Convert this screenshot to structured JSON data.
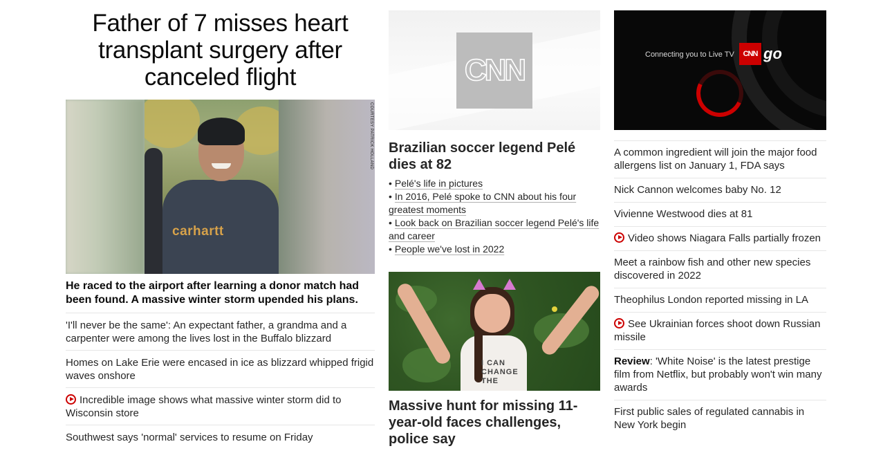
{
  "left": {
    "headline": "Father of 7 misses heart transplant surgery after canceled flight",
    "photo_credit": "COURTESY PATRICK HOLLAND",
    "shirt_logo": "carhartt",
    "caption": "He raced to the airport after learning a donor match had been found. A massive winter storm upended his plans.",
    "related": [
      {
        "text": "'I'll never be the same': An expectant father, a grandma and a carpenter were among the lives lost in the Buffalo blizzard",
        "video": false
      },
      {
        "text": "Homes on Lake Erie were encased in ice as blizzard whipped frigid waves onshore",
        "video": false
      },
      {
        "text": "Incredible image shows what massive winter storm did to Wisconsin store",
        "video": true
      },
      {
        "text": "Southwest says 'normal' services to resume on Friday",
        "video": false
      }
    ]
  },
  "middle": {
    "cnn_logo_text": "CNN",
    "headline": "Brazilian soccer legend Pelé dies at 82",
    "bullets": [
      "Pelé's life in pictures",
      "In 2016, Pelé spoke to CNN about his four greatest moments",
      "Look back on Brazilian soccer legend Pelé's life and career",
      "People we've lost in 2022"
    ],
    "shirt_text": "I CAN CHANGE THE",
    "headline2": "Massive hunt for missing 11-year-old faces challenges, police say"
  },
  "right": {
    "video": {
      "connecting_text": "Connecting you to Live TV",
      "badge_text": "CNN",
      "go_text": "go"
    },
    "list": [
      {
        "prefix": "",
        "text": "A common ingredient will join the major food allergens list on January 1, FDA says",
        "video": false
      },
      {
        "prefix": "",
        "text": "Nick Cannon welcomes baby No. 12",
        "video": false
      },
      {
        "prefix": "",
        "text": "Vivienne Westwood dies at 81",
        "video": false
      },
      {
        "prefix": "",
        "text": "Video shows Niagara Falls partially frozen",
        "video": true
      },
      {
        "prefix": "",
        "text": "Meet a rainbow fish and other new species discovered in 2022",
        "video": false
      },
      {
        "prefix": "",
        "text": "Theophilus London reported missing in LA",
        "video": false
      },
      {
        "prefix": "",
        "text": "See Ukrainian forces shoot down Russian missile",
        "video": true
      },
      {
        "prefix": "Review",
        "text": ": 'White Noise' is the latest prestige film from Netflix, but probably won't win many awards",
        "video": false
      },
      {
        "prefix": "",
        "text": "First public sales of regulated cannabis in New York begin",
        "video": false
      }
    ]
  },
  "colors": {
    "accent_red": "#cc0000",
    "text": "#0c0c0c",
    "divider": "#e6e6e6"
  }
}
